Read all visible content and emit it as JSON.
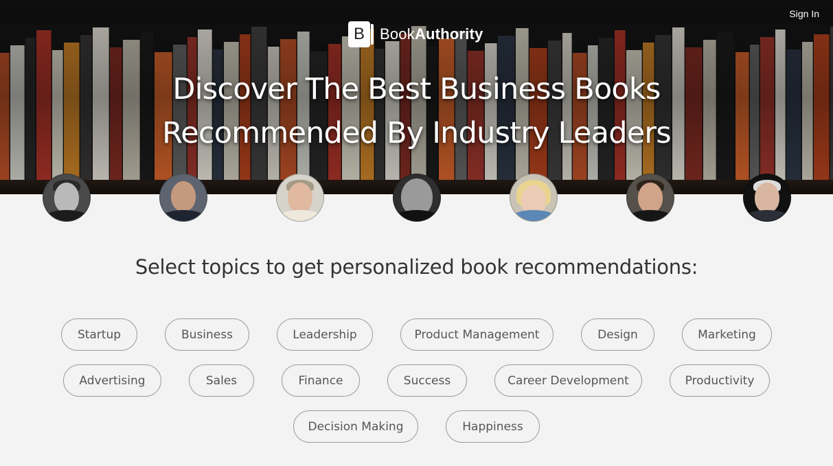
{
  "header": {
    "sign_in_label": "Sign In",
    "logo": {
      "mark": "B",
      "text_light": "Book",
      "text_bold": "Authority"
    }
  },
  "hero": {
    "title_line_1": "Discover The Best Business Books",
    "title_line_2": "Recommended By Industry Leaders"
  },
  "avatars": [
    {
      "name": "avatar-1"
    },
    {
      "name": "avatar-2"
    },
    {
      "name": "avatar-3"
    },
    {
      "name": "avatar-4"
    },
    {
      "name": "avatar-5"
    },
    {
      "name": "avatar-6"
    },
    {
      "name": "avatar-7"
    }
  ],
  "topics": {
    "prompt": "Select topics to get personalized book recommendations:",
    "items": [
      "Startup",
      "Business",
      "Leadership",
      "Product Management",
      "Design",
      "Marketing",
      "Advertising",
      "Sales",
      "Finance",
      "Success",
      "Career Development",
      "Productivity",
      "Decision Making",
      "Happiness"
    ]
  },
  "colors": {
    "hero_background": "#161616",
    "page_background": "#f3f3f3",
    "pill_border": "#9a9a9a",
    "pill_text": "#555555",
    "prompt_text": "#333333"
  }
}
